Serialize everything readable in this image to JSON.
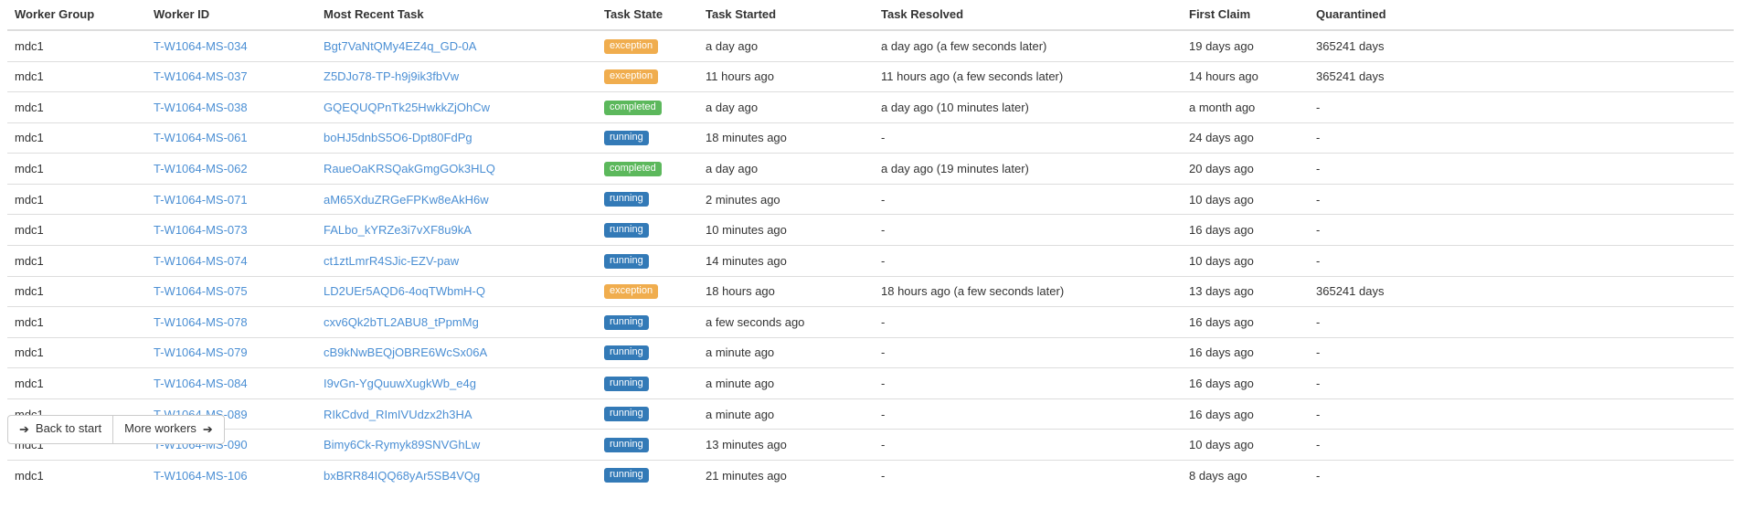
{
  "table": {
    "columns": [
      {
        "key": "worker_group",
        "label": "Worker Group"
      },
      {
        "key": "worker_id",
        "label": "Worker ID"
      },
      {
        "key": "most_recent_task",
        "label": "Most Recent Task"
      },
      {
        "key": "task_state",
        "label": "Task State"
      },
      {
        "key": "task_started",
        "label": "Task Started"
      },
      {
        "key": "task_resolved",
        "label": "Task Resolved"
      },
      {
        "key": "first_claim",
        "label": "First Claim"
      },
      {
        "key": "quarantined",
        "label": "Quarantined"
      }
    ],
    "rows": [
      {
        "worker_group": "mdc1",
        "worker_id": "T-W1064-MS-034",
        "most_recent_task": "Bgt7VaNtQMy4EZ4q_GD-0A",
        "task_state": "exception",
        "task_started": "a day ago",
        "task_resolved": "a day ago (a few seconds later)",
        "first_claim": "19 days ago",
        "quarantined": "365241 days"
      },
      {
        "worker_group": "mdc1",
        "worker_id": "T-W1064-MS-037",
        "most_recent_task": "Z5DJo78-TP-h9j9ik3fbVw",
        "task_state": "exception",
        "task_started": "11 hours ago",
        "task_resolved": "11 hours ago (a few seconds later)",
        "first_claim": "14 hours ago",
        "quarantined": "365241 days"
      },
      {
        "worker_group": "mdc1",
        "worker_id": "T-W1064-MS-038",
        "most_recent_task": "GQEQUQPnTk25HwkkZjOhCw",
        "task_state": "completed",
        "task_started": "a day ago",
        "task_resolved": "a day ago (10 minutes later)",
        "first_claim": "a month ago",
        "quarantined": "-"
      },
      {
        "worker_group": "mdc1",
        "worker_id": "T-W1064-MS-061",
        "most_recent_task": "boHJ5dnbS5O6-Dpt80FdPg",
        "task_state": "running",
        "task_started": "18 minutes ago",
        "task_resolved": "-",
        "first_claim": "24 days ago",
        "quarantined": "-"
      },
      {
        "worker_group": "mdc1",
        "worker_id": "T-W1064-MS-062",
        "most_recent_task": "RaueOaKRSQakGmgGOk3HLQ",
        "task_state": "completed",
        "task_started": "a day ago",
        "task_resolved": "a day ago (19 minutes later)",
        "first_claim": "20 days ago",
        "quarantined": "-"
      },
      {
        "worker_group": "mdc1",
        "worker_id": "T-W1064-MS-071",
        "most_recent_task": "aM65XduZRGeFPKw8eAkH6w",
        "task_state": "running",
        "task_started": "2 minutes ago",
        "task_resolved": "-",
        "first_claim": "10 days ago",
        "quarantined": "-"
      },
      {
        "worker_group": "mdc1",
        "worker_id": "T-W1064-MS-073",
        "most_recent_task": "FALbo_kYRZe3i7vXF8u9kA",
        "task_state": "running",
        "task_started": "10 minutes ago",
        "task_resolved": "-",
        "first_claim": "16 days ago",
        "quarantined": "-"
      },
      {
        "worker_group": "mdc1",
        "worker_id": "T-W1064-MS-074",
        "most_recent_task": "ct1ztLmrR4SJic-EZV-paw",
        "task_state": "running",
        "task_started": "14 minutes ago",
        "task_resolved": "-",
        "first_claim": "10 days ago",
        "quarantined": "-"
      },
      {
        "worker_group": "mdc1",
        "worker_id": "T-W1064-MS-075",
        "most_recent_task": "LD2UEr5AQD6-4oqTWbmH-Q",
        "task_state": "exception",
        "task_started": "18 hours ago",
        "task_resolved": "18 hours ago (a few seconds later)",
        "first_claim": "13 days ago",
        "quarantined": "365241 days"
      },
      {
        "worker_group": "mdc1",
        "worker_id": "T-W1064-MS-078",
        "most_recent_task": "cxv6Qk2bTL2ABU8_tPpmMg",
        "task_state": "running",
        "task_started": "a few seconds ago",
        "task_resolved": "-",
        "first_claim": "16 days ago",
        "quarantined": "-"
      },
      {
        "worker_group": "mdc1",
        "worker_id": "T-W1064-MS-079",
        "most_recent_task": "cB9kNwBEQjOBRE6WcSx06A",
        "task_state": "running",
        "task_started": "a minute ago",
        "task_resolved": "-",
        "first_claim": "16 days ago",
        "quarantined": "-"
      },
      {
        "worker_group": "mdc1",
        "worker_id": "T-W1064-MS-084",
        "most_recent_task": "I9vGn-YgQuuwXugkWb_e4g",
        "task_state": "running",
        "task_started": "a minute ago",
        "task_resolved": "-",
        "first_claim": "16 days ago",
        "quarantined": "-"
      },
      {
        "worker_group": "mdc1",
        "worker_id": "T-W1064-MS-089",
        "most_recent_task": "RIkCdvd_RImIVUdzx2h3HA",
        "task_state": "running",
        "task_started": "a minute ago",
        "task_resolved": "-",
        "first_claim": "16 days ago",
        "quarantined": "-"
      },
      {
        "worker_group": "mdc1",
        "worker_id": "T-W1064-MS-090",
        "most_recent_task": "Bimy6Ck-Rymyk89SNVGhLw",
        "task_state": "running",
        "task_started": "13 minutes ago",
        "task_resolved": "-",
        "first_claim": "10 days ago",
        "quarantined": "-"
      },
      {
        "worker_group": "mdc1",
        "worker_id": "T-W1064-MS-106",
        "most_recent_task": "bxBRR84IQQ68yAr5SB4VQg",
        "task_state": "running",
        "task_started": "21 minutes ago",
        "task_resolved": "-",
        "first_claim": "8 days ago",
        "quarantined": "-"
      }
    ]
  },
  "pagination": {
    "back_label": "Back to start",
    "back_icon": "arrow-left-icon",
    "more_label": "More workers",
    "more_icon": "arrow-right-icon"
  },
  "colors": {
    "link": "#4b8fd4",
    "badge_exception": "#f0ad4e",
    "badge_completed": "#5cb85c",
    "badge_running": "#337ab7",
    "border": "#dddddd",
    "text": "#333333"
  }
}
